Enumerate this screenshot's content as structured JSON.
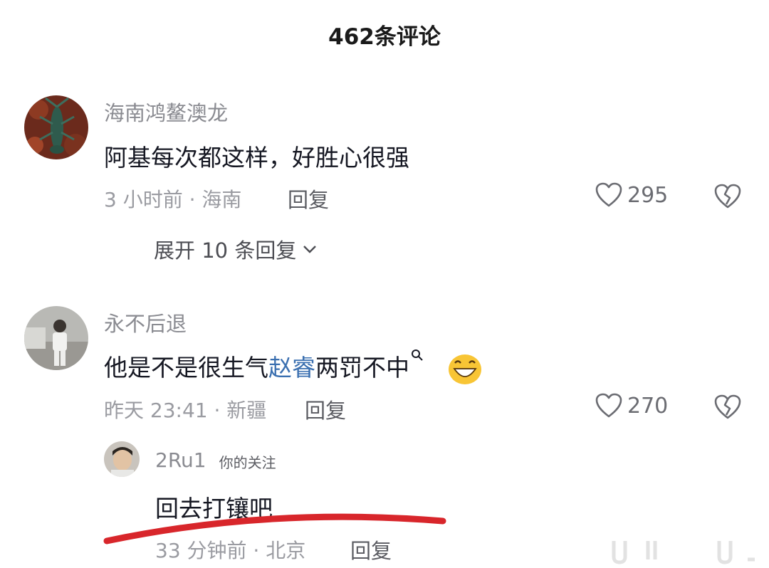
{
  "header": {
    "title": "462条评论"
  },
  "comments": [
    {
      "username": "海南鸿鳌澳龙",
      "content": "阿基每次都这样，好胜心很强",
      "meta": "3 小时前 · 海南",
      "reply_label": "回复",
      "likes": "295",
      "expand_label": "展开 10 条回复"
    },
    {
      "username": "永不后退",
      "content_prefix": "他是不是很生气",
      "content_mention": "赵睿",
      "content_suffix": "两罚不中",
      "meta": "昨天 23:41 · 新疆",
      "reply_label": "回复",
      "likes": "270"
    }
  ],
  "reply": {
    "username": "2Ru1",
    "tag": "你的关注",
    "content": "回去打镶吧",
    "meta": "33 分钟前 · 北京",
    "reply_label": "回复"
  },
  "colors": {
    "mention": "#3a6fb0",
    "annotation_line": "#d8262b"
  }
}
